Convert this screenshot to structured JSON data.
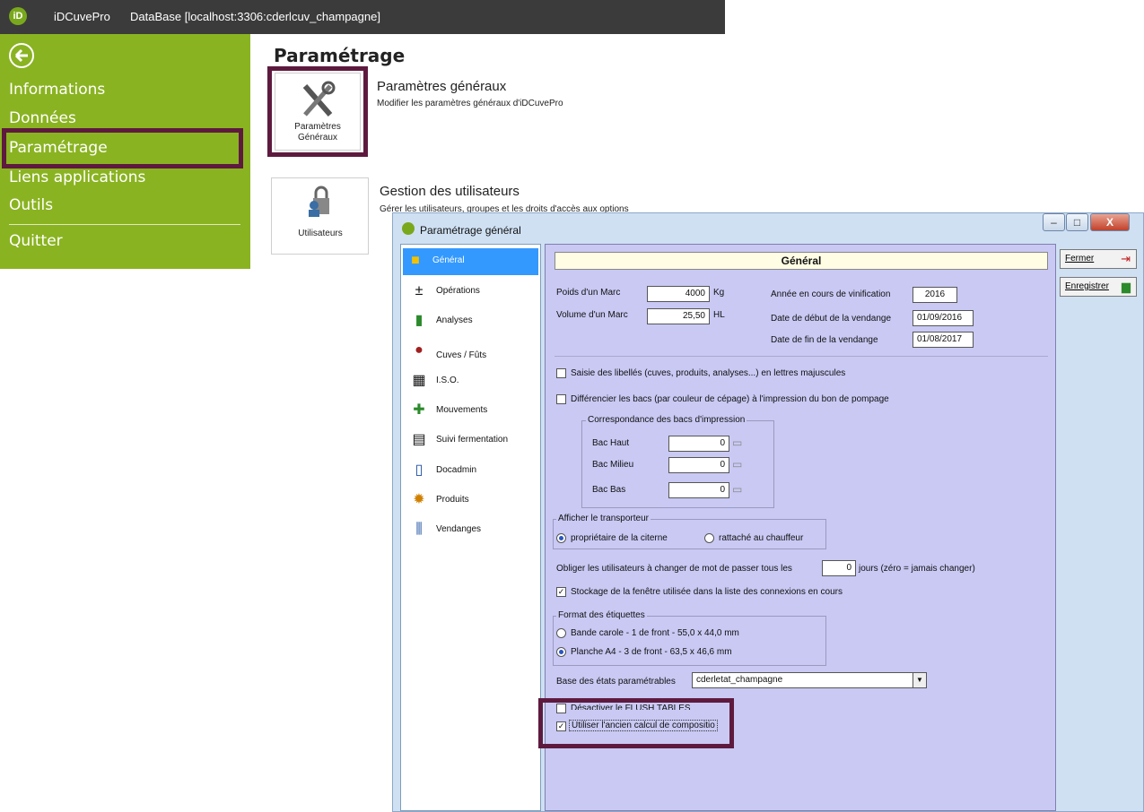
{
  "app": {
    "logo": "iD",
    "name": "iDCuvePro",
    "database": "DataBase [localhost:3306:cderlcuv_champagne]"
  },
  "sidebar": {
    "items": [
      "Informations",
      "Données",
      "Paramétrage",
      "Liens applications",
      "Outils",
      "Quitter"
    ]
  },
  "main": {
    "title": "Paramétrage",
    "sections": [
      {
        "tile_label": "Paramètres Généraux",
        "title": "Paramètres généraux",
        "desc": "Modifier les paramètres généraux d'iDCuvePro"
      },
      {
        "tile_label": "Utilisateurs",
        "title": "Gestion des utilisateurs",
        "desc": "Gérer les utilisateurs, groupes et les droits d'accès aux options"
      }
    ]
  },
  "dialog": {
    "title": "Paramétrage général",
    "nav": [
      "Général",
      "Opérations",
      "Analyses",
      "Cuves / Fûts",
      "I.S.O.",
      "Mouvements",
      "Suivi fermentation",
      "Docadmin",
      "Produits",
      "Vendanges"
    ],
    "buttons": {
      "close": "Fermer",
      "save": "Enregistrer"
    },
    "header": "Général",
    "poids_label": "Poids d'un Marc",
    "poids_value": "4000",
    "poids_unit": "Kg",
    "volume_label": "Volume d'un Marc",
    "volume_value": "25,50",
    "volume_unit": "HL",
    "annee_label": "Année en cours de vinification",
    "annee_value": "2016",
    "debut_label": "Date de début de la vendange",
    "debut_value": "01/09/2016",
    "fin_label": "Date de fin de la vendange",
    "fin_value": "01/08/2017",
    "chk_majuscules": "Saisie des libellés (cuves, produits, analyses...) en lettres majuscules",
    "chk_bacs": "Différencier les bacs (par couleur de cépage) à l'impression du bon de pompage",
    "bacs_group": "Correspondance des bacs d'impression",
    "bac_haut": "Bac Haut",
    "bac_haut_value": "0",
    "bac_milieu": "Bac Milieu",
    "bac_milieu_value": "0",
    "bac_bas": "Bac Bas",
    "bac_bas_value": "0",
    "transporteur_group": "Afficher le transporteur",
    "radio_citerne": "propriétaire de la citerne",
    "radio_chauffeur": "rattaché au chauffeur",
    "mdp_label": "Obliger les utilisateurs à changer de mot de passer tous les",
    "mdp_value": "0",
    "mdp_suffix": "jours (zéro = jamais changer)",
    "chk_stockage": "Stockage de la fenêtre utilisée dans la liste des connexions en cours",
    "format_group": "Format des étiquettes",
    "radio_bande": "Bande carole - 1 de front - 55,0 x 44,0 mm",
    "radio_planche": "Planche A4 - 3 de front - 63,5 x 46,6 mm",
    "base_label": "Base des états paramétrables",
    "base_value": "cderletat_champagne",
    "chk_flush": "Désactiver le FLUSH TABLES",
    "chk_calcul": "Utiliser l'ancien calcul de compositio"
  }
}
